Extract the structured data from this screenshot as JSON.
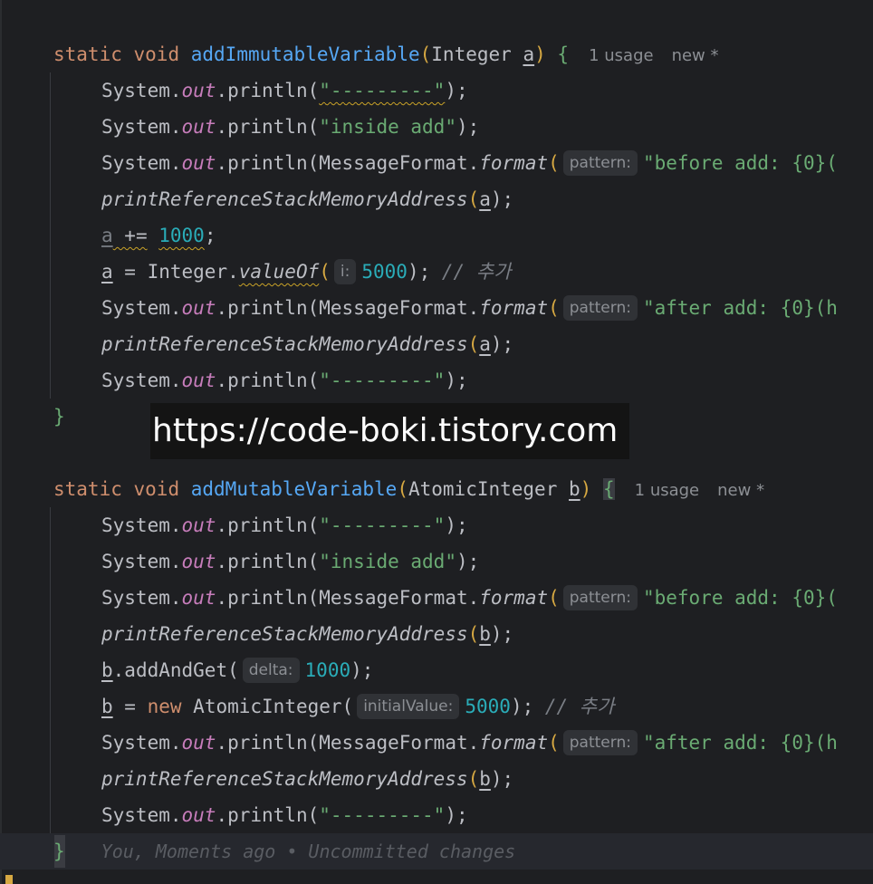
{
  "method1": {
    "decl": {
      "kw1": "static",
      "kw2": "void",
      "name": "addImmutableVariable",
      "open": "(",
      "ptype": "Integer",
      "pname": "a",
      "close": ")",
      "brace": "{",
      "usage": "1 usage",
      "status": "new *"
    },
    "lines": {
      "l1": {
        "obj": "System.",
        "fld": "out",
        "rest": ".println(",
        "str": "\"---------\"",
        "end": ");"
      },
      "l2": {
        "obj": "System.",
        "fld": "out",
        "rest": ".println(",
        "str": "\"inside add\"",
        "end": ");"
      },
      "l3": {
        "obj": "System.",
        "fld": "out",
        "rest": ".println(MessageFormat.",
        "fmt": "format",
        "paren": "(",
        "hint": "pattern:",
        "str": "\"before add: {0}("
      },
      "l4": {
        "call": "printReferenceStackMemoryAddress",
        "open": "(",
        "arg": "a",
        "end": ");"
      },
      "l5": {
        "var": "a",
        "op": " +=",
        "num": "1000",
        "end": ";"
      },
      "l6": {
        "var": "a",
        "mid": " = Integer.",
        "fn": "valueOf",
        "paren": "(",
        "hint": "i:",
        "num": "5000",
        "end": "); ",
        "cmt": "// 추가"
      },
      "l7": {
        "obj": "System.",
        "fld": "out",
        "rest": ".println(MessageFormat.",
        "fmt": "format",
        "paren": "(",
        "hint": "pattern:",
        "str": "\"after add: {0}(h"
      },
      "l8": {
        "call": "printReferenceStackMemoryAddress",
        "open": "(",
        "arg": "a",
        "end": ");"
      },
      "l9": {
        "obj": "System.",
        "fld": "out",
        "rest": ".println(",
        "str": "\"---------\"",
        "end": ");"
      }
    },
    "close": "}"
  },
  "watermark": "https://code-boki.tistory.com",
  "method2": {
    "decl": {
      "kw1": "static",
      "kw2": "void",
      "name": "addMutableVariable",
      "open": "(",
      "ptype": "AtomicInteger",
      "pname": "b",
      "close": ")",
      "brace": "{",
      "usage": "1 usage",
      "status": "new *"
    },
    "lines": {
      "l1": {
        "obj": "System.",
        "fld": "out",
        "rest": ".println(",
        "str": "\"---------\"",
        "end": ");"
      },
      "l2": {
        "obj": "System.",
        "fld": "out",
        "rest": ".println(",
        "str": "\"inside add\"",
        "end": ");"
      },
      "l3": {
        "obj": "System.",
        "fld": "out",
        "rest": ".println(MessageFormat.",
        "fmt": "format",
        "paren": "(",
        "hint": "pattern:",
        "str": "\"before add: {0}("
      },
      "l4": {
        "call": "printReferenceStackMemoryAddress",
        "open": "(",
        "arg": "b",
        "end": ");"
      },
      "l5": {
        "var": "b",
        "rest": ".addAndGet(",
        "hint": "delta:",
        "num": "1000",
        "end": ");"
      },
      "l6": {
        "var": "b",
        "mid": " = ",
        "kw": "new",
        "cls": " AtomicInteger(",
        "hint": "initialValue:",
        "num": "5000",
        "end": "); ",
        "cmt": "// 추가"
      },
      "l7": {
        "obj": "System.",
        "fld": "out",
        "rest": ".println(MessageFormat.",
        "fmt": "format",
        "paren": "(",
        "hint": "pattern:",
        "str": "\"after add: {0}(h"
      },
      "l8": {
        "call": "printReferenceStackMemoryAddress",
        "open": "(",
        "arg": "b",
        "end": ");"
      },
      "l9": {
        "obj": "System.",
        "fld": "out",
        "rest": ".println(",
        "str": "\"---------\"",
        "end": ");"
      }
    },
    "close": "}",
    "blame": "You, Moments ago • Uncommitted changes"
  },
  "colors": {
    "background": "#1e1f22",
    "keyword": "#cf8e6d",
    "function": "#56a8f5",
    "string": "#6aab73",
    "number": "#2aacb8",
    "field": "#c77dbb",
    "comment": "#7a7e85",
    "text": "#bcbec4"
  }
}
